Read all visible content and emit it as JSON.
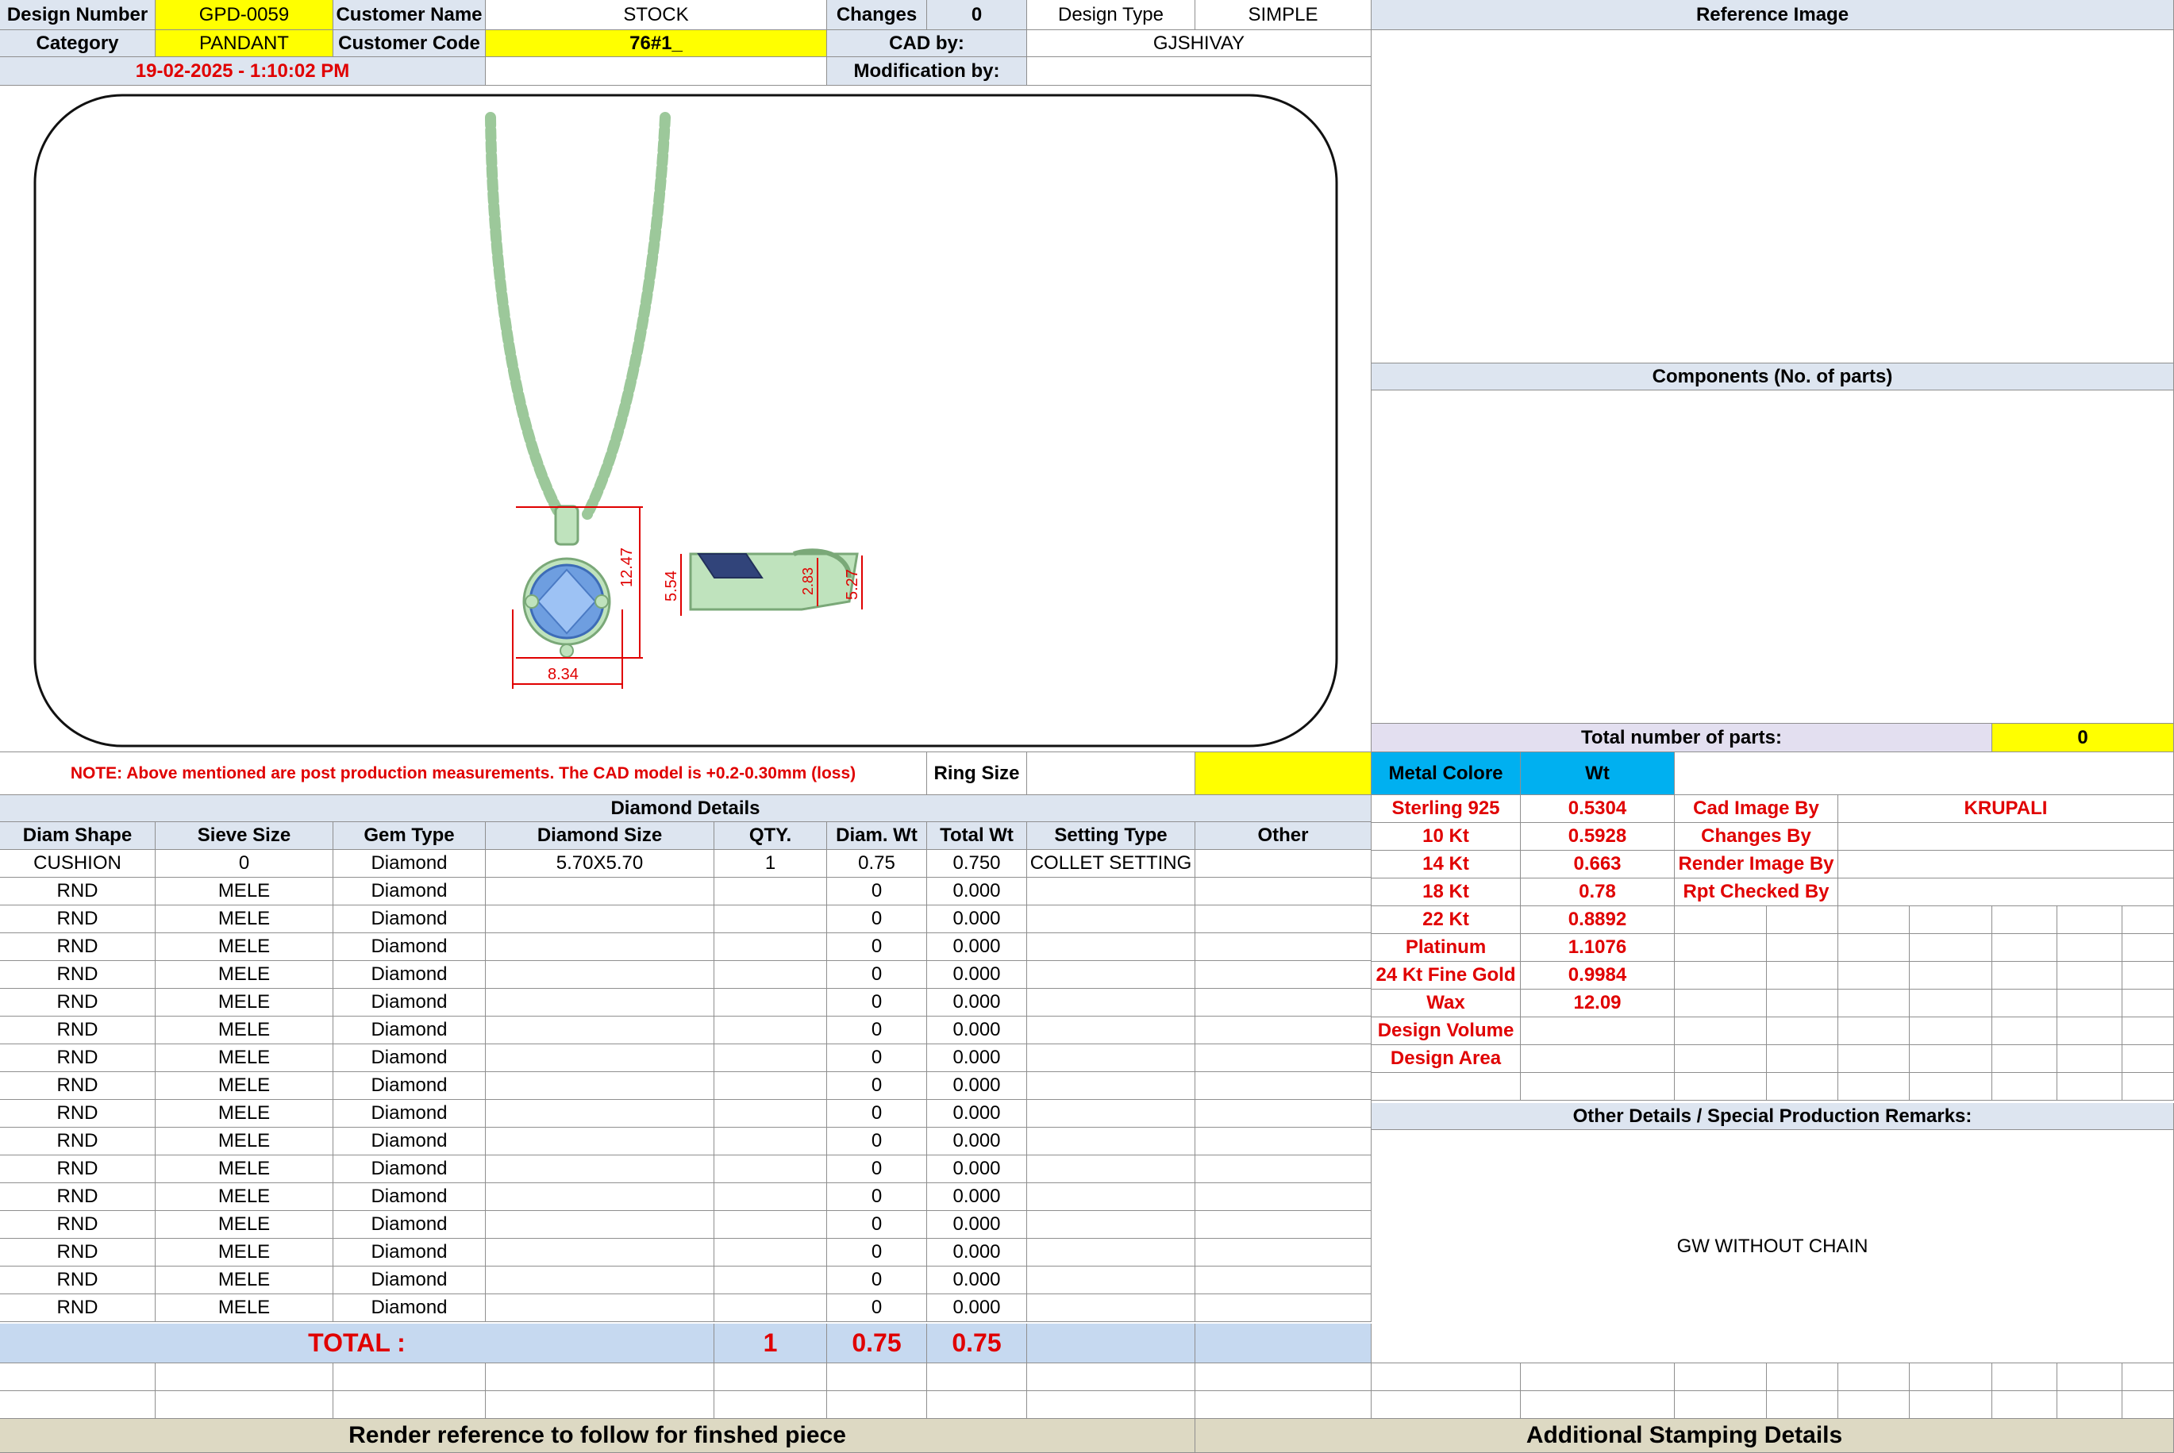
{
  "header": {
    "design_number_label": "Design Number",
    "design_number": "GPD-0059",
    "customer_name_label": "Customer Name",
    "customer_name": "STOCK",
    "changes_label": "Changes",
    "changes": "0",
    "design_type_label": "Design Type",
    "design_type": "SIMPLE",
    "category_label": "Category",
    "category": "PANDANT",
    "customer_code_label": "Customer Code",
    "customer_code": "76#1_",
    "cad_by_label": "CAD by:",
    "cad_by": "GJSHIVAY",
    "timestamp": "19-02-2025 - 1:10:02 PM",
    "modification_by_label": "Modification by:",
    "modification_by": ""
  },
  "drawing": {
    "dim_height": "12.47",
    "dim_width": "8.34",
    "dim_side_height": "5.54",
    "dim_depth": "2.83",
    "dim_bail": "5.27"
  },
  "right_panel": {
    "reference_image_title": "Reference Image",
    "components_title": "Components (No. of parts)",
    "total_parts_label": "Total number of parts:",
    "total_parts": "0",
    "metal_colore_label": "Metal Colore",
    "wt_label": "Wt",
    "metals": [
      {
        "name": "Sterling 925",
        "wt": "0.5304"
      },
      {
        "name": "10 Kt",
        "wt": "0.5928"
      },
      {
        "name": "14 Kt",
        "wt": "0.663"
      },
      {
        "name": "18 Kt",
        "wt": "0.78"
      },
      {
        "name": "22 Kt",
        "wt": "0.8892"
      },
      {
        "name": "Platinum",
        "wt": "1.1076"
      },
      {
        "name": "24 Kt Fine Gold",
        "wt": "0.9984"
      },
      {
        "name": "Wax",
        "wt": "12.09"
      },
      {
        "name": "Design Volume",
        "wt": ""
      },
      {
        "name": "Design Area",
        "wt": ""
      }
    ],
    "cad_image_by_label": "Cad Image By",
    "cad_image_by": "KRUPALI",
    "changes_by_label": "Changes By",
    "render_image_by_label": "Render Image By",
    "rpt_checked_by_label": "Rpt Checked By",
    "other_details_title": "Other Details / Special Production Remarks:",
    "remarks": "GW WITHOUT CHAIN"
  },
  "note": "NOTE: Above mentioned are post production measurements. The CAD model is +0.2-0.30mm (loss)",
  "ring_size_label": "Ring Size",
  "diamond": {
    "title": "Diamond Details",
    "columns": [
      "Diam Shape",
      "Sieve Size",
      "Gem Type",
      "Diamond Size",
      "QTY.",
      "Diam. Wt",
      "Total Wt",
      "Setting Type",
      "Other"
    ],
    "rows": [
      [
        "CUSHION",
        "0",
        "Diamond",
        "5.70X5.70",
        "1",
        "0.75",
        "0.750",
        "COLLET SETTING",
        ""
      ],
      [
        "RND",
        "MELE",
        "Diamond",
        "",
        "",
        "0",
        "0.000",
        "",
        ""
      ],
      [
        "RND",
        "MELE",
        "Diamond",
        "",
        "",
        "0",
        "0.000",
        "",
        ""
      ],
      [
        "RND",
        "MELE",
        "Diamond",
        "",
        "",
        "0",
        "0.000",
        "",
        ""
      ],
      [
        "RND",
        "MELE",
        "Diamond",
        "",
        "",
        "0",
        "0.000",
        "",
        ""
      ],
      [
        "RND",
        "MELE",
        "Diamond",
        "",
        "",
        "0",
        "0.000",
        "",
        ""
      ],
      [
        "RND",
        "MELE",
        "Diamond",
        "",
        "",
        "0",
        "0.000",
        "",
        ""
      ],
      [
        "RND",
        "MELE",
        "Diamond",
        "",
        "",
        "0",
        "0.000",
        "",
        ""
      ],
      [
        "RND",
        "MELE",
        "Diamond",
        "",
        "",
        "0",
        "0.000",
        "",
        ""
      ],
      [
        "RND",
        "MELE",
        "Diamond",
        "",
        "",
        "0",
        "0.000",
        "",
        ""
      ],
      [
        "RND",
        "MELE",
        "Diamond",
        "",
        "",
        "0",
        "0.000",
        "",
        ""
      ],
      [
        "RND",
        "MELE",
        "Diamond",
        "",
        "",
        "0",
        "0.000",
        "",
        ""
      ],
      [
        "RND",
        "MELE",
        "Diamond",
        "",
        "",
        "0",
        "0.000",
        "",
        ""
      ],
      [
        "RND",
        "MELE",
        "Diamond",
        "",
        "",
        "0",
        "0.000",
        "",
        ""
      ],
      [
        "RND",
        "MELE",
        "Diamond",
        "",
        "",
        "0",
        "0.000",
        "",
        ""
      ],
      [
        "RND",
        "MELE",
        "Diamond",
        "",
        "",
        "0",
        "0.000",
        "",
        ""
      ],
      [
        "RND",
        "MELE",
        "Diamond",
        "",
        "",
        "0",
        "0.000",
        "",
        ""
      ]
    ],
    "total_label": "TOTAL :",
    "total_qty": "1",
    "total_diam_wt": "0.75",
    "total_wt": "0.75"
  },
  "footer": {
    "render_reference": "Render reference to follow for finshed piece",
    "stamping": "Additional Stamping Details"
  }
}
